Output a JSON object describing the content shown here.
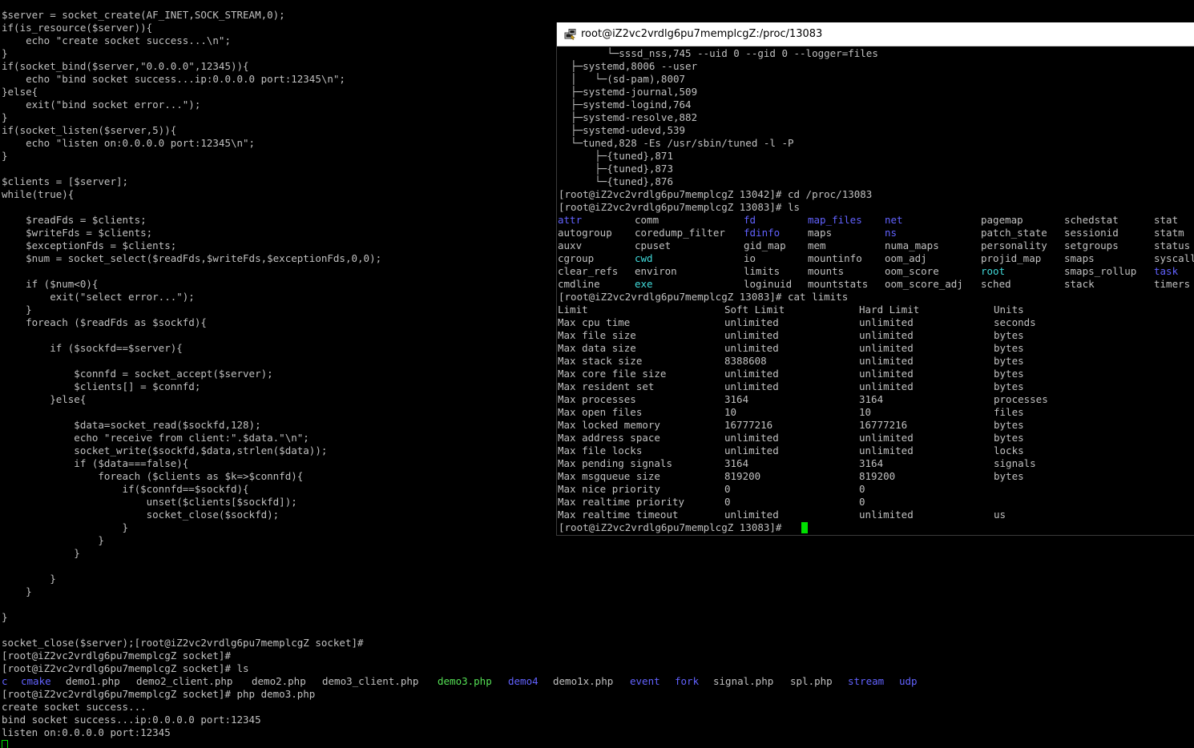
{
  "background_terminal": {
    "code_lines": [
      "$server = socket_create(AF_INET,SOCK_STREAM,0);",
      "if(is_resource($server)){",
      "    echo \"create socket success...\\n\";",
      "}",
      "if(socket_bind($server,\"0.0.0.0\",12345)){",
      "    echo \"bind socket success...ip:0.0.0.0 port:12345\\n\";",
      "}else{",
      "    exit(\"bind socket error...\");",
      "}",
      "if(socket_listen($server,5)){",
      "    echo \"listen on:0.0.0.0 port:12345\\n\";",
      "}",
      "",
      "$clients = [$server];",
      "while(true){",
      "",
      "    $readFds = $clients;",
      "    $writeFds = $clients;",
      "    $exceptionFds = $clients;",
      "    $num = socket_select($readFds,$writeFds,$exceptionFds,0,0);",
      "",
      "    if ($num<0){",
      "        exit(\"select error...\");",
      "    }",
      "    foreach ($readFds as $sockfd){",
      "",
      "        if ($sockfd==$server){",
      "",
      "            $connfd = socket_accept($server);",
      "            $clients[] = $connfd;",
      "        }else{",
      "",
      "            $data=socket_read($sockfd,128);",
      "            echo \"receive from client:\".$data.\"\\n\";",
      "            socket_write($sockfd,$data,strlen($data));",
      "            if ($data===false){",
      "                foreach ($clients as $k=>$connfd){",
      "                    if($connfd==$sockfd){",
      "                        unset($clients[$sockfd]);",
      "                        socket_close($sockfd);",
      "                    }",
      "                }",
      "            }",
      "",
      "        }",
      "    }",
      "",
      "}",
      "",
      "socket_close($server);[root@iZ2vc2vrdlg6pu7memplcgZ socket]#",
      "[root@iZ2vc2vrdlg6pu7memplcgZ socket]#",
      "[root@iZ2vc2vrdlg6pu7memplcgZ socket]# ls"
    ],
    "ls_listing": [
      {
        "name": "c",
        "color": "blue"
      },
      {
        "name": "cmake",
        "color": "blue"
      },
      {
        "name": "demo1.php",
        "color": "default"
      },
      {
        "name": "demo2_client.php",
        "color": "default"
      },
      {
        "name": "demo2.php",
        "color": "default"
      },
      {
        "name": "demo3_client.php",
        "color": "default"
      },
      {
        "name": "demo3.php",
        "color": "green"
      },
      {
        "name": "demo4",
        "color": "blue"
      },
      {
        "name": "demo1x.php",
        "color": "default"
      },
      {
        "name": "event",
        "color": "blue"
      },
      {
        "name": "fork",
        "color": "blue"
      },
      {
        "name": "signal.php",
        "color": "default"
      },
      {
        "name": "spl.php",
        "color": "default"
      },
      {
        "name": "stream",
        "color": "blue"
      },
      {
        "name": "udp",
        "color": "blue"
      }
    ],
    "output_lines": [
      "[root@iZ2vc2vrdlg6pu7memplcgZ socket]# php demo3.php",
      "create socket success...",
      "bind socket success...ip:0.0.0.0 port:12345",
      "listen on:0.0.0.0 port:12345"
    ]
  },
  "window": {
    "title": "root@iZ2vc2vrdlg6pu7memplcgZ:/proc/13083",
    "tree_lines": [
      "        └─sssd_nss,745 --uid 0 --gid 0 --logger=files",
      "  ├─systemd,8006 --user",
      "  │   └─(sd-pam),8007",
      "  ├─systemd-journal,509",
      "  ├─systemd-logind,764",
      "  ├─systemd-resolve,882",
      "  ├─systemd-udevd,539",
      "  └─tuned,828 -Es /usr/sbin/tuned -l -P",
      "      ├─{tuned},871",
      "      ├─{tuned},873",
      "      └─{tuned},876",
      "[root@iZ2vc2vrdlg6pu7memplcgZ 13042]# cd /proc/13083",
      "[root@iZ2vc2vrdlg6pu7memplcgZ 13083]# ls"
    ],
    "proc_ls_rows": [
      [
        {
          "name": "attr",
          "color": "blue"
        },
        {
          "name": "comm",
          "color": "default"
        },
        {
          "name": "fd",
          "color": "blue"
        },
        {
          "name": "map_files",
          "color": "blue"
        },
        {
          "name": "net",
          "color": "blue"
        },
        {
          "name": "pagemap",
          "color": "default"
        },
        {
          "name": "schedstat",
          "color": "default"
        },
        {
          "name": "stat",
          "color": "default"
        }
      ],
      [
        {
          "name": "autogroup",
          "color": "default"
        },
        {
          "name": "coredump_filter",
          "color": "default"
        },
        {
          "name": "fdinfo",
          "color": "blue"
        },
        {
          "name": "maps",
          "color": "default"
        },
        {
          "name": "ns",
          "color": "blue"
        },
        {
          "name": "patch_state",
          "color": "default"
        },
        {
          "name": "sessionid",
          "color": "default"
        },
        {
          "name": "statm",
          "color": "default"
        }
      ],
      [
        {
          "name": "auxv",
          "color": "default"
        },
        {
          "name": "cpuset",
          "color": "default"
        },
        {
          "name": "gid_map",
          "color": "default"
        },
        {
          "name": "mem",
          "color": "default"
        },
        {
          "name": "numa_maps",
          "color": "default"
        },
        {
          "name": "personality",
          "color": "default"
        },
        {
          "name": "setgroups",
          "color": "default"
        },
        {
          "name": "status",
          "color": "default"
        }
      ],
      [
        {
          "name": "cgroup",
          "color": "default"
        },
        {
          "name": "cwd",
          "color": "cyan"
        },
        {
          "name": "io",
          "color": "default"
        },
        {
          "name": "mountinfo",
          "color": "default"
        },
        {
          "name": "oom_adj",
          "color": "default"
        },
        {
          "name": "projid_map",
          "color": "default"
        },
        {
          "name": "smaps",
          "color": "default"
        },
        {
          "name": "syscall",
          "color": "default"
        }
      ],
      [
        {
          "name": "clear_refs",
          "color": "default"
        },
        {
          "name": "environ",
          "color": "default"
        },
        {
          "name": "limits",
          "color": "default"
        },
        {
          "name": "mounts",
          "color": "default"
        },
        {
          "name": "oom_score",
          "color": "default"
        },
        {
          "name": "root",
          "color": "cyan"
        },
        {
          "name": "smaps_rollup",
          "color": "default"
        },
        {
          "name": "task",
          "color": "blue"
        }
      ],
      [
        {
          "name": "cmdline",
          "color": "default"
        },
        {
          "name": "exe",
          "color": "cyan"
        },
        {
          "name": "loginuid",
          "color": "default"
        },
        {
          "name": "mountstats",
          "color": "default"
        },
        {
          "name": "oom_score_adj",
          "color": "default"
        },
        {
          "name": "sched",
          "color": "default"
        },
        {
          "name": "stack",
          "color": "default"
        },
        {
          "name": "timers",
          "color": "default"
        }
      ]
    ],
    "cat_command": "[root@iZ2vc2vrdlg6pu7memplcgZ 13083]# cat limits",
    "limits_header": [
      "Limit",
      "Soft Limit",
      "Hard Limit",
      "Units"
    ],
    "limits_rows": [
      [
        "Max cpu time",
        "unlimited",
        "unlimited",
        "seconds"
      ],
      [
        "Max file size",
        "unlimited",
        "unlimited",
        "bytes"
      ],
      [
        "Max data size",
        "unlimited",
        "unlimited",
        "bytes"
      ],
      [
        "Max stack size",
        "8388608",
        "unlimited",
        "bytes"
      ],
      [
        "Max core file size",
        "unlimited",
        "unlimited",
        "bytes"
      ],
      [
        "Max resident set",
        "unlimited",
        "unlimited",
        "bytes"
      ],
      [
        "Max processes",
        "3164",
        "3164",
        "processes"
      ],
      [
        "Max open files",
        "10",
        "10",
        "files"
      ],
      [
        "Max locked memory",
        "16777216",
        "16777216",
        "bytes"
      ],
      [
        "Max address space",
        "unlimited",
        "unlimited",
        "bytes"
      ],
      [
        "Max file locks",
        "unlimited",
        "unlimited",
        "locks"
      ],
      [
        "Max pending signals",
        "3164",
        "3164",
        "signals"
      ],
      [
        "Max msgqueue size",
        "819200",
        "819200",
        "bytes"
      ],
      [
        "Max nice priority",
        "0",
        "0",
        ""
      ],
      [
        "Max realtime priority",
        "0",
        "0",
        ""
      ],
      [
        "Max realtime timeout",
        "unlimited",
        "unlimited",
        "us"
      ]
    ],
    "final_prompt": "[root@iZ2vc2vrdlg6pu7memplcgZ 13083]# "
  },
  "colors": {
    "text": "#c0c0c0",
    "directory": "#6262ff",
    "executable": "#55e055",
    "symlink": "#40d8d8",
    "cursor": "#00e000"
  },
  "icons": {
    "window_icon": "putty-terminal-icon"
  }
}
